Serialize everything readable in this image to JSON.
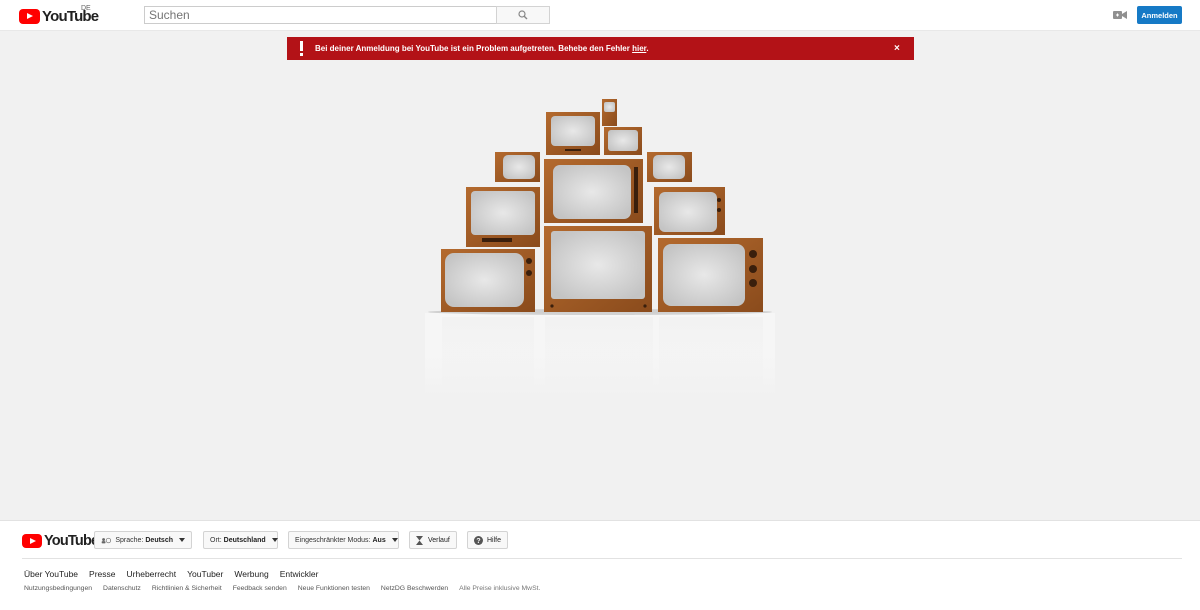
{
  "header": {
    "logo_text": "YouTube",
    "region": "DE",
    "search_placeholder": "Suchen",
    "signin_label": "Anmelden",
    "icons": {
      "search": "search-icon",
      "upload": "video-camera-icon"
    }
  },
  "alert": {
    "message": "Bei deiner Anmeldung bei YouTube ist ein Problem aufgetreten. Behebe den Fehler ",
    "link_text": "hier",
    "suffix": ".",
    "close": "×",
    "color": "#b31217"
  },
  "footer": {
    "logo_text": "YouTube",
    "language_label": "Sprache:",
    "language_value": "Deutsch",
    "location_label": "Ort:",
    "location_value": "Deutschland",
    "restricted_label": "Eingeschränkter Modus:",
    "restricted_value": "Aus",
    "history_label": "Verlauf",
    "help_label": "Hilfe",
    "primary_links": [
      "Über YouTube",
      "Presse",
      "Urheberrecht",
      "YouTuber",
      "Werbung",
      "Entwickler"
    ],
    "secondary_links": [
      "Nutzungsbedingungen",
      "Datenschutz",
      "Richtlinien & Sicherheit",
      "Feedback senden",
      "Neue Funktionen testen",
      "NetzDG Beschwerden"
    ],
    "price_note": "Alle Preise inklusive MwSt."
  },
  "colors": {
    "brand_red": "#ff0000",
    "accent_blue": "#167ac6"
  }
}
